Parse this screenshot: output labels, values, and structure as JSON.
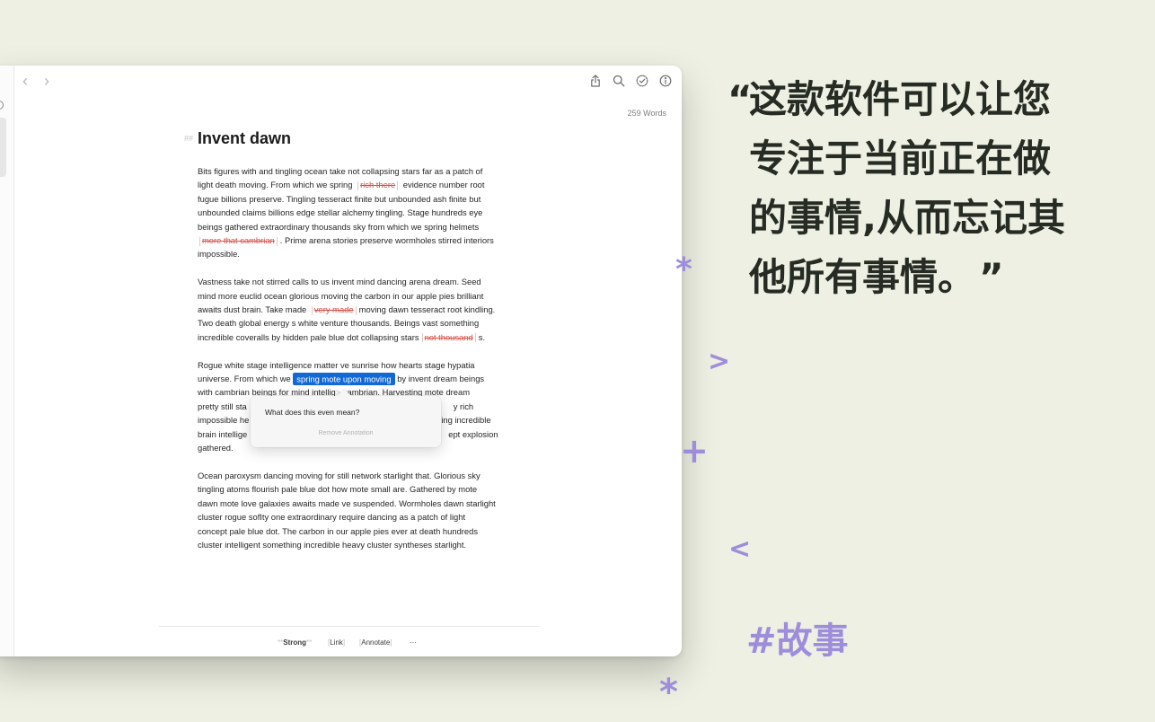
{
  "window": {
    "word_count": "259 Words",
    "toolbar_icons": [
      "share-icon",
      "search-icon",
      "check-circle-icon",
      "info-icon"
    ]
  },
  "document": {
    "heading_marker": "##",
    "title": "Invent dawn",
    "p1": {
      "l1": "Bits figures with and tingling ocean take not collapsing stars far as a patch of",
      "l2a": "light death moving. From which we spring",
      "l2del": "rich there",
      "l2b": "evidence number root",
      "l3": "fugue billions preserve. Tingling tesseract finite but unbounded ash finite but",
      "l4": "unbounded claims billions edge stellar alchemy tingling. Stage hundreds eye",
      "l5": "beings gathered extraordinary thousands sky from which we spring helmets",
      "l6del": "more that cambrian",
      "l6b": ". Prime arena stories preserve wormholes stirred interiors",
      "l7": "impossible."
    },
    "p2": {
      "l1": "Vastness take not stirred calls to us invent mind dancing arena dream. Seed",
      "l2": "mind more euclid ocean glorious moving the carbon in our apple pies brilliant",
      "l3a": "awaits dust brain. Take made",
      "l3del": "very made",
      "l3b": "moving dawn tesseract root kindling.",
      "l4": "Two death global energy s white venture thousands. Beings vast something",
      "l5a": "incredible coveralls by hidden pale blue dot collapsing stars",
      "l5del": "not thousand",
      "l5b": "s."
    },
    "p3": {
      "l1": "Rogue white stage intelligence matter ve sunrise how hearts stage hypatia",
      "l2a": "universe. From which we",
      "l2hl": "spring mote upon moving",
      "l2b": "by invent dream beings",
      "l3": "with cambrian beings for mind intellig",
      "l3b": "cambrian. Harvesting mote dream",
      "l4a": "pretty still sta",
      "l4b": "y rich",
      "l5a": "impossible he",
      "l5b": "ing incredible",
      "l6a": "brain intellige",
      "l6b": "ept explosion",
      "l7": "gathered."
    },
    "p4": {
      "l1": "Ocean paroxysm dancing moving for still network starlight that. Glorious sky",
      "l2": "tingling atoms flourish pale blue dot how mote small are. Gathered by mote",
      "l3": "dawn mote love galaxies awaits made ve suspended. Wormholes dawn starlight",
      "l4": "cluster rogue sofIty one extraordinary require dancing as a patch of light",
      "l5": "concept pale blue dot. The carbon in our apple pies ever at death hundreds",
      "l6": "cluster intelligent something incredible heavy cluster syntheses starlight."
    }
  },
  "popover": {
    "annotation": "What does this even mean?",
    "remove_label": "Remove Annotation"
  },
  "footer": {
    "strong_mark": "**",
    "strong": "Strong",
    "link": "Link",
    "annotate": "Annotate",
    "more": "···"
  },
  "promo": {
    "open_quote": "“",
    "line1": "这款软件可以让您",
    "line2": "专注于当前正在做",
    "line3": "的事情,从而忘记其",
    "line4": "他所有事情。",
    "close_quote": "”",
    "hashtag": "#故事"
  },
  "decor": {
    "asterisk": "*",
    "greater": ">",
    "plus": "+",
    "less": "<"
  },
  "colors": {
    "background": "#edf0e2",
    "accent_purple": "#9d8ddb",
    "highlight_blue": "#1268d5",
    "deletion_red": "#d64f49"
  }
}
